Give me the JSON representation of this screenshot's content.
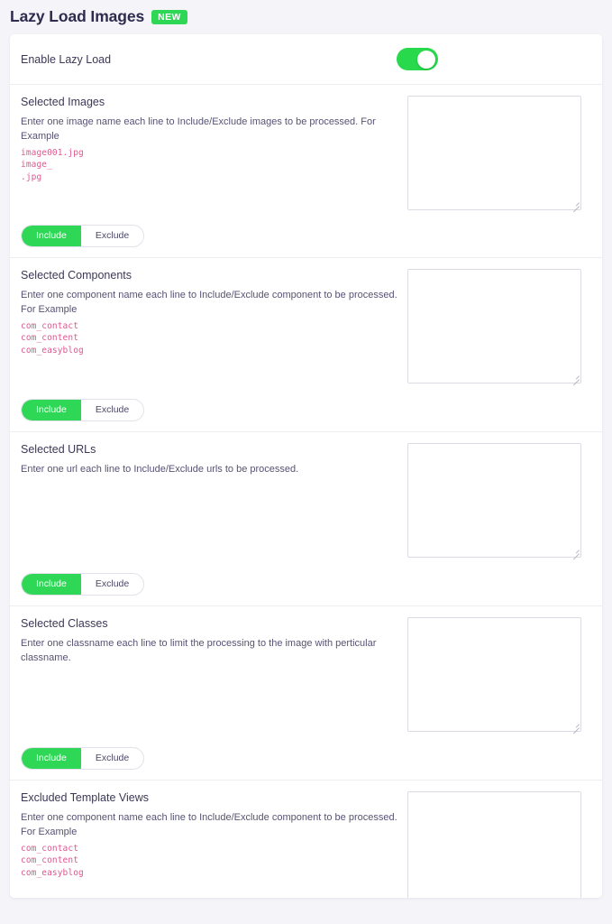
{
  "header": {
    "title": "Lazy Load Images",
    "badge": "NEW"
  },
  "enable_row": {
    "label": "Enable Lazy Load",
    "toggle_state": "on"
  },
  "segmented": {
    "include_label": "Include",
    "exclude_label": "Exclude",
    "active": "Include"
  },
  "colors": {
    "accent_green": "#2fd757",
    "toggle_green": "#27d94b",
    "code_pink": "#e0568f",
    "title_navy": "#2f2b4e",
    "page_bg": "#f5f4f9",
    "card_bg": "#ffffff",
    "divider": "#ededf2"
  },
  "blocks": [
    {
      "title": "Selected Images",
      "description": "Enter one image name each line to Include/Exclude images to be processed. For Example",
      "examples": [
        "image001.jpg",
        "image_",
        ".jpg"
      ],
      "textarea_value": "",
      "has_segmented": true
    },
    {
      "title": "Selected Components",
      "description": "Enter one component name each line to Include/Exclude component to be processed. For Example",
      "examples": [
        "com_contact",
        "com_content",
        "com_easyblog"
      ],
      "textarea_value": "",
      "has_segmented": true
    },
    {
      "title": "Selected URLs",
      "description": "Enter one url each line to Include/Exclude urls to be processed.",
      "examples": [],
      "textarea_value": "",
      "has_segmented": true
    },
    {
      "title": "Selected Classes",
      "description": "Enter one classname each line to limit the processing to the image with perticular classname.",
      "examples": [],
      "textarea_value": "",
      "has_segmented": true
    },
    {
      "title": "Excluded Template Views",
      "description": "Enter one component name each line to Include/Exclude component to be processed. For Example",
      "examples": [
        "com_contact",
        "com_content",
        "com_easyblog"
      ],
      "textarea_value": "",
      "has_segmented": false
    }
  ]
}
